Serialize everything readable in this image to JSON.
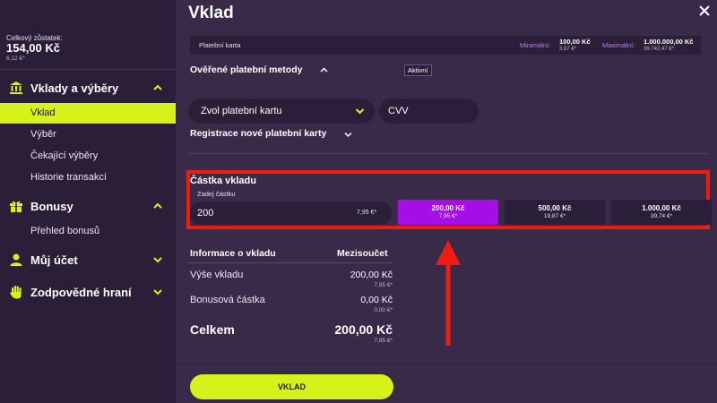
{
  "balance": {
    "label": "Celkový zůstatek:",
    "value": "154,00 Kč",
    "sub": "6,12 €*"
  },
  "sidebar": {
    "sections": [
      {
        "label": "Vklady a výběry",
        "icon": "bank-icon",
        "expanded": true
      },
      {
        "label": "Bonusy",
        "icon": "gift-icon",
        "expanded": true
      },
      {
        "label": "Můj účet",
        "icon": "user-icon",
        "expanded": false
      },
      {
        "label": "Zodpovědné hraní",
        "icon": "hand-icon",
        "expanded": false
      }
    ],
    "deposits_items": [
      "Vklad",
      "Výběr",
      "Čekající výběry",
      "Historie transakcí"
    ],
    "bonus_items": [
      "Přehled bonusů"
    ],
    "active_item": "Vklad"
  },
  "header": {
    "title": "Vklad"
  },
  "payment_method": {
    "name": "Platební karta",
    "min_label": "Minimální:",
    "min_value": "100,00 Kč",
    "min_sub": "3,97 €*",
    "max_label": "Maximální:",
    "max_value": "1.000.000,00 Kč",
    "max_sub": "39.742,47 €*"
  },
  "verified_methods": {
    "label": "Ověřené platební metody",
    "badge": "Aktivní"
  },
  "card_select": {
    "value": "Zvol platební kartu"
  },
  "cvv": {
    "placeholder": "CVV"
  },
  "register_card": {
    "label": "Registrace nové platební karty"
  },
  "deposit_amount": {
    "title": "Částka vkladu",
    "hint": "Zadej částku",
    "value": "200",
    "value_eur": "7,95 €*",
    "presets": [
      {
        "value": "200,00 Kč",
        "sub": "7,95 €*",
        "selected": true
      },
      {
        "value": "500,00 Kč",
        "sub": "19,87 €*",
        "selected": false
      },
      {
        "value": "1.000,00 Kč",
        "sub": "39,74 €*",
        "selected": false
      }
    ]
  },
  "info": {
    "header_left": "Informace o vkladu",
    "header_right": "Mezisoučet",
    "rows": [
      {
        "label": "Výše vkladu",
        "value": "200,00 Kč",
        "sub": "7,95 €*"
      },
      {
        "label": "Bonusová částka",
        "value": "0,00 Kč",
        "sub": "0,00 €*"
      }
    ],
    "total_label": "Celkem",
    "total_value": "200,00 Kč",
    "total_sub": "7,95 €*"
  },
  "submit": {
    "label": "VKLAD"
  },
  "colors": {
    "accent": "#d6f21b",
    "selected_preset": "#a50ee6",
    "highlight": "#ee1c0e",
    "background": "#3a2a4a",
    "sidebar": "#2b1e38"
  }
}
